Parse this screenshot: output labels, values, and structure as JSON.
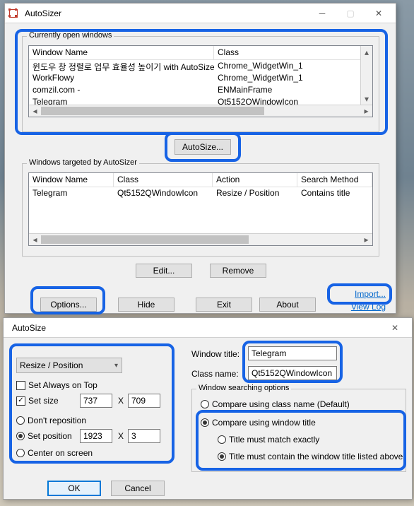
{
  "main": {
    "title": "AutoSizer",
    "group_open": "Currently open windows",
    "open_cols": [
      "Window Name",
      "Class"
    ],
    "open_rows": [
      {
        "name": "윈도우 창 정렬로 업무 효율성 높이기 with AutoSize...",
        "cls": "Chrome_WidgetWin_1"
      },
      {
        "name": "WorkFlowy",
        "cls": "Chrome_WidgetWin_1"
      },
      {
        "name": "comzil.com -",
        "cls": "ENMainFrame"
      },
      {
        "name": "Telegram",
        "cls": "Qt5152QWindowIcon"
      }
    ],
    "btn_autosize": "AutoSize...",
    "group_target": "Windows targeted by AutoSizer",
    "target_cols": [
      "Window Name",
      "Class",
      "Action",
      "Search Method"
    ],
    "target_rows": [
      {
        "name": "Telegram",
        "cls": "Qt5152QWindowIcon",
        "action": "Resize / Position",
        "method": "Contains title"
      }
    ],
    "btn_edit": "Edit...",
    "btn_remove": "Remove",
    "btn_options": "Options...",
    "btn_hide": "Hide",
    "btn_exit": "Exit",
    "btn_about": "About",
    "link_import": "Import...",
    "link_viewlog": "View Log"
  },
  "dlg": {
    "title": "AutoSize",
    "action_combo": "Resize / Position",
    "chk_ontop": "Set Always on Top",
    "chk_setsize": "Set size",
    "size_w": "737",
    "size_x": "X",
    "size_h": "709",
    "chk_noreposition": "Don't reposition",
    "chk_setpos": "Set position",
    "pos_x": "1923",
    "pos_xlbl": "X",
    "pos_y": "3",
    "chk_center": "Center on screen",
    "lbl_wintitle": "Window title:",
    "val_wintitle": "Telegram",
    "lbl_classname": "Class name:",
    "val_classname": "Qt5152QWindowIcon",
    "group_search": "Window searching options",
    "r_class": "Compare using class name (Default)",
    "r_title": "Compare using window title",
    "r_exact": "Title must match exactly",
    "r_contain": "Title must contain the window title listed above",
    "btn_ok": "OK",
    "btn_cancel": "Cancel"
  }
}
